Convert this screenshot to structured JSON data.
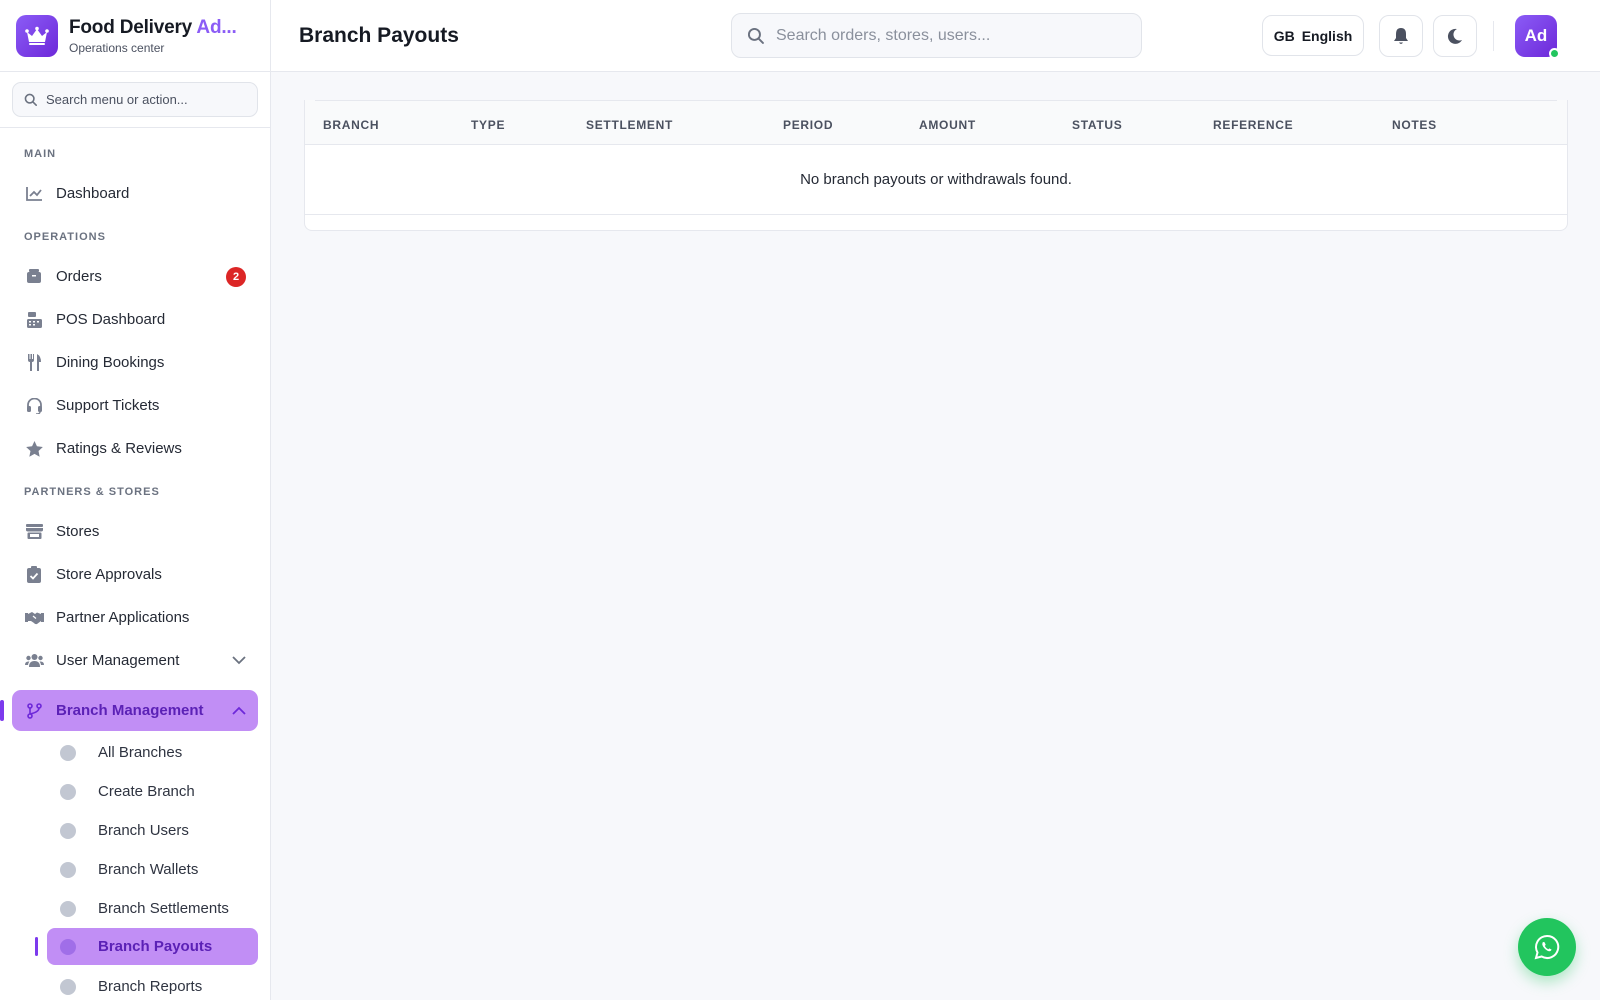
{
  "brand": {
    "title_main": "Food Delivery ",
    "title_accent": "Ad...",
    "subtitle": "Operations center"
  },
  "sidebar": {
    "search_placeholder": "Search menu or action...",
    "sections": {
      "main": "MAIN",
      "operations": "OPERATIONS",
      "partners": "PARTNERS & STORES"
    },
    "items": {
      "dashboard": "Dashboard",
      "orders": "Orders",
      "orders_badge": "2",
      "pos": "POS Dashboard",
      "dining": "Dining Bookings",
      "support": "Support Tickets",
      "ratings": "Ratings & Reviews",
      "stores": "Stores",
      "store_approvals": "Store Approvals",
      "partner_applications": "Partner Applications",
      "user_management": "User Management",
      "branch_management": "Branch Management"
    },
    "branch_sub": {
      "all": "All Branches",
      "create": "Create Branch",
      "users": "Branch Users",
      "wallets": "Branch Wallets",
      "settlements": "Branch Settlements",
      "payouts": "Branch Payouts",
      "reports": "Branch Reports"
    }
  },
  "header": {
    "page_title": "Branch Payouts",
    "search_placeholder": "Search orders, stores, users...",
    "lang_code": "GB",
    "lang_label": "English",
    "avatar_initials": "Ad"
  },
  "table": {
    "columns": [
      "BRANCH",
      "TYPE",
      "SETTLEMENT",
      "PERIOD",
      "AMOUNT",
      "STATUS",
      "REFERENCE",
      "NOTES"
    ],
    "empty_message": "No branch payouts or withdrawals found."
  },
  "colors": {
    "accent": "#8b5cf6",
    "active_bg": "#c18ef5",
    "badge": "#dc2626",
    "whatsapp": "#22c55e"
  }
}
